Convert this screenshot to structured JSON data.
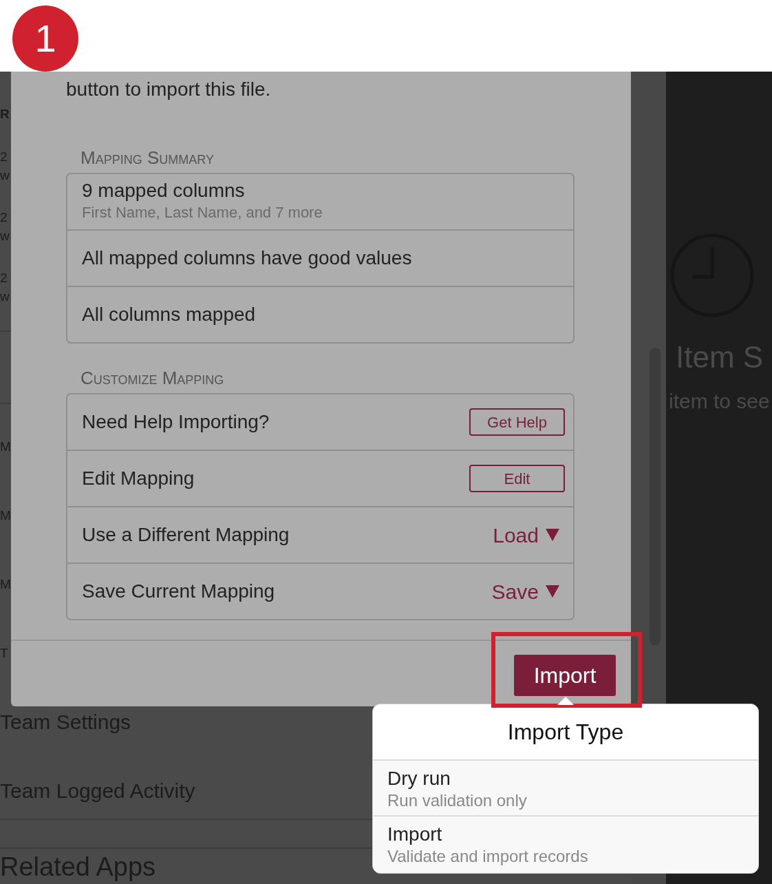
{
  "step_badge": "1",
  "sidebar": {
    "items": [
      {
        "kind": "heading",
        "text": "R"
      },
      {
        "kind": "pair",
        "line1": "2",
        "line2": "w"
      },
      {
        "kind": "pair",
        "line1": "2",
        "line2": "w"
      },
      {
        "kind": "pair",
        "line1": "2",
        "line2": "w"
      },
      {
        "kind": "gap"
      },
      {
        "kind": "item",
        "text": "M"
      },
      {
        "kind": "item",
        "text": "M"
      },
      {
        "kind": "item",
        "text": "M"
      },
      {
        "kind": "item",
        "text": "T"
      },
      {
        "kind": "item",
        "text": "Team Settings"
      },
      {
        "kind": "item",
        "text": "Team Logged Activity"
      },
      {
        "kind": "gap"
      },
      {
        "kind": "large",
        "text": "Related Apps"
      }
    ]
  },
  "detail": {
    "title": "Item S",
    "hint": "item to see"
  },
  "modal": {
    "intro": "button to import this file.",
    "sections": [
      {
        "heading": "Mapping Summary",
        "rows": [
          {
            "kind": "summary",
            "title": "9 mapped columns",
            "subtitle": "First Name, Last Name, and 7 more"
          },
          {
            "kind": "text",
            "title": "All mapped columns have good values"
          },
          {
            "kind": "text",
            "title": "All columns mapped"
          }
        ]
      },
      {
        "heading": "Customize Mapping",
        "rows": [
          {
            "kind": "button",
            "title": "Need Help Importing?",
            "action": "Get Help"
          },
          {
            "kind": "button",
            "title": "Edit Mapping",
            "action": "Edit"
          },
          {
            "kind": "dropdown",
            "title": "Use a Different Mapping",
            "action": "Load"
          },
          {
            "kind": "dropdown",
            "title": "Save Current Mapping",
            "action": "Save"
          }
        ]
      }
    ],
    "import_button": {
      "label": "Import",
      "highlighted": true
    }
  },
  "popover": {
    "title": "Import Type",
    "options": [
      {
        "title": "Dry run",
        "description": "Run validation only"
      },
      {
        "title": "Import",
        "description": "Validate and import records"
      }
    ]
  }
}
